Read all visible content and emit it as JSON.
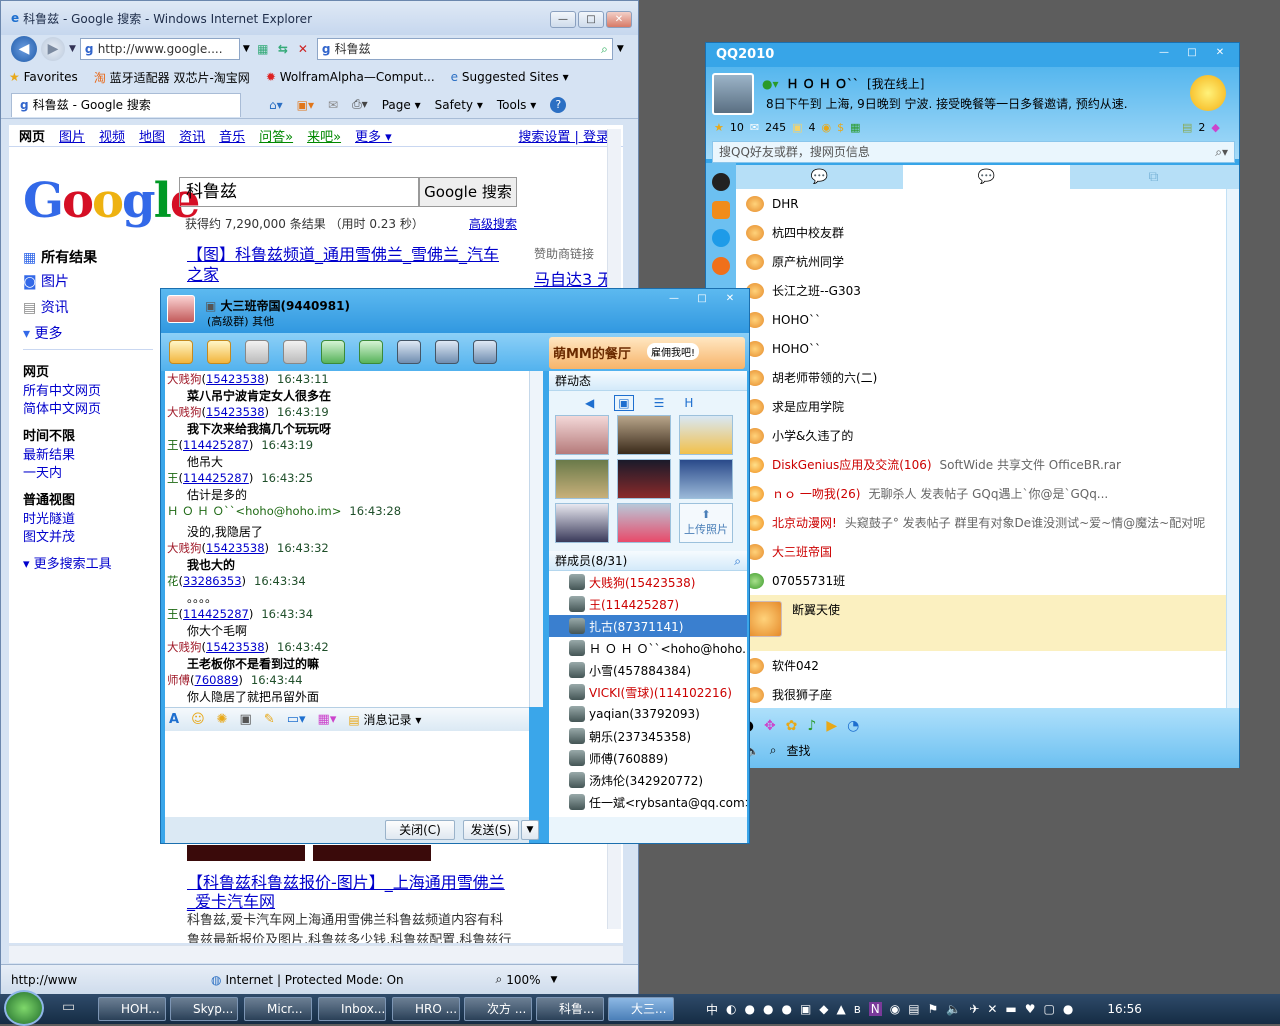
{
  "ie": {
    "title": "科鲁兹 - Google 搜索 - Windows Internet Explorer",
    "address": "http://www.google....",
    "search_value": "科鲁兹",
    "favorites_label": "Favorites",
    "fav_links": [
      "蓝牙适配器 双芯片-淘宝网",
      "WolframAlpha—Comput...",
      "Suggested Sites"
    ],
    "tab_title": "科鲁兹 - Google 搜索",
    "cmd_items": [
      "Page",
      "Safety",
      "Tools"
    ],
    "status_left": "http://www",
    "status_zone": "Internet | Protected Mode: On",
    "zoom": "100%"
  },
  "google": {
    "nav": [
      "网页",
      "图片",
      "视频",
      "地图",
      "资讯",
      "音乐",
      "问答»",
      "来吧»",
      "更多 ▾"
    ],
    "nav_right": "搜索设置 | 登录",
    "logo": "Google",
    "query": "科鲁兹",
    "search_btn": "Google 搜索",
    "stats": "获得约 7,290,000 条结果 （用时 0.23 秒）",
    "advanced": "高级搜索",
    "left_main": [
      "所有结果",
      "图片",
      "资讯",
      "更多"
    ],
    "left_groups": [
      {
        "title": "网页",
        "items": [
          "所有中文网页",
          "简体中文网页"
        ]
      },
      {
        "title": "时间不限",
        "items": [
          "最新结果",
          "一天内"
        ]
      },
      {
        "title": "普通视图",
        "items": [
          "时光隧道",
          "图文并茂"
        ]
      }
    ],
    "more_tools": "更多搜索工具",
    "result1_title": "【图】科鲁兹频道_通用雪佛兰_雪佛兰_汽车之家",
    "ads_label": "赞助商链接",
    "ad_title": "马自达3 无",
    "result2_title_line1": "【科鲁兹科鲁兹报价-图片】_上海通用雪佛兰",
    "result2_title_line2": "_爱卡汽车网",
    "result2_snip1": "科鲁兹,爱卡汽车网上海通用雪佛兰科鲁兹频道内容有科",
    "result2_snip2": "鲁兹最新报价及图片,科鲁兹多少钱,科鲁兹配置,科鲁兹行"
  },
  "qq": {
    "title": "QQ2010",
    "nick": "Ｈ Ｏ Ｈ Ｏ``",
    "status": "[我在线上]",
    "signature": "8日下午到 上海, 9日晚到 宁波. 接受晚餐等一日多餐邀请, 预约从速.",
    "counts": [
      "10",
      "245",
      "4"
    ],
    "right_count": "2",
    "search_placeholder": "搜QQ好友或群，搜网页信息",
    "list": [
      {
        "name": "DHR",
        "desc": ""
      },
      {
        "name": "杭四中校友群",
        "desc": ""
      },
      {
        "name": "原产杭州同学",
        "desc": ""
      },
      {
        "name": "长江之班--G303",
        "desc": ""
      },
      {
        "name": "HOHO``",
        "desc": ""
      },
      {
        "name": "HOHO``",
        "desc": ""
      },
      {
        "name": "胡老师带领的六(二)",
        "desc": ""
      },
      {
        "name": "求是应用学院",
        "desc": ""
      },
      {
        "name": "小学&久违了的",
        "desc": ""
      },
      {
        "name": "DiskGenius应用及交流(106)",
        "desc": "SoftWide 共享文件 OfficeBR.rar"
      },
      {
        "name": "ｎｏ 一吻我(26)",
        "desc": "无聊杀人 发表帖子 GQq遇上`你@是`GQq..."
      },
      {
        "name": "北京动漫网!",
        "desc": "头窥鼓子° 发表帖子 群里有对象De谁没测试~爱~情@魔法~配对呢"
      },
      {
        "name": "大三班帝国",
        "desc": ""
      },
      {
        "name": "07055731班",
        "desc": ""
      }
    ],
    "highlighted": "断翼天使",
    "list_after": [
      "软件042",
      "我很狮子座"
    ],
    "find_label": "查找"
  },
  "chat": {
    "title": "大三班帝国(9440981)",
    "subtitle": "(高级群) 其他",
    "banner": "萌MM的餐厅",
    "banner_bubble": "雇佣我吧!",
    "messages": [
      {
        "sender": "大贱狗",
        "num": "15423538",
        "time": "16:43:11",
        "text": "菜八吊宁波肯定女人很多在",
        "bold": true
      },
      {
        "sender": "大贱狗",
        "num": "15423538",
        "time": "16:43:19",
        "text": "我下次来给我搞几个玩玩呀",
        "bold": true
      },
      {
        "sender": "王",
        "num": "114425287",
        "time": "16:43:19",
        "text": "他吊大",
        "bold": false
      },
      {
        "sender": "王",
        "num": "114425287",
        "time": "16:43:25",
        "text": "估计是多的",
        "bold": false
      },
      {
        "sender": "Ｈ Ｏ Ｈ Ｏ``",
        "num": "<hoho@hoho.im>",
        "time": "16:43:28",
        "text": "没的,我隐居了",
        "bold": false
      },
      {
        "sender": "大贱狗",
        "num": "15423538",
        "time": "16:43:32",
        "text": "我也大的",
        "bold": true
      },
      {
        "sender": "花",
        "num": "33286353",
        "time": "16:43:34",
        "text": "。。。。",
        "bold": false
      },
      {
        "sender": "王",
        "num": "114425287",
        "time": "16:43:34",
        "text": "你大个毛啊",
        "bold": false
      },
      {
        "sender": "大贱狗",
        "num": "15423538",
        "time": "16:43:42",
        "text": "王老板你不是看到过的嘛",
        "bold": true
      },
      {
        "sender": "师傅",
        "num": "760889",
        "time": "16:43:44",
        "text": "你人隐居了就把吊留外面",
        "bold": false
      }
    ],
    "msg_record": "消息记录",
    "close_btn": "关闭(C)",
    "send_btn": "发送(S)",
    "dynamics_label": "群动态",
    "upload_label": "上传照片",
    "members_label": "群成员(8/31)",
    "members": [
      "大贱狗(15423538)",
      "王(114425287)",
      "扎古(87371141)",
      "Ｈ Ｏ Ｈ Ｏ``<hoho@hoho...",
      "小雪(457884384)",
      "VICKI(雪球)(114102216)",
      "yaqian(33792093)",
      "朝乐(237345358)",
      "师傅(760889)",
      "汤炜伦(342920772)",
      "任一斌<rybsanta@qq.com>"
    ]
  },
  "taskbar": {
    "tasks": [
      "HOH...",
      "Skyp...",
      "Micr...",
      "Inbox...",
      "HRO ...",
      "次方 ...",
      "科鲁...",
      "大三..."
    ],
    "ime": "中",
    "clock": "16:56"
  }
}
